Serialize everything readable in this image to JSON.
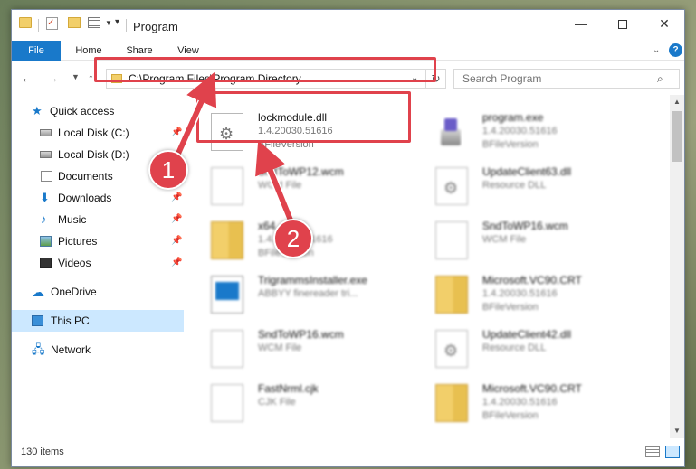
{
  "window": {
    "title": "Program",
    "controls": {
      "minimize": "—",
      "close": "✕"
    }
  },
  "ribbon": {
    "tabs": [
      {
        "label": "File"
      },
      {
        "label": "Home"
      },
      {
        "label": "Share"
      },
      {
        "label": "View"
      }
    ],
    "help": "?"
  },
  "address": {
    "path": "C:\\Program Files\\Program Directory"
  },
  "search": {
    "placeholder": "Search Program"
  },
  "sidebar": {
    "items": [
      {
        "label": "Quick access"
      },
      {
        "label": "Local Disk (C:)"
      },
      {
        "label": "Local Disk (D:)"
      },
      {
        "label": "Documents"
      },
      {
        "label": "Downloads"
      },
      {
        "label": "Music"
      },
      {
        "label": "Pictures"
      },
      {
        "label": "Videos"
      },
      {
        "label": "OneDrive"
      },
      {
        "label": "This PC"
      },
      {
        "label": "Network"
      }
    ]
  },
  "files": [
    {
      "name": "lockmodule.dll",
      "line1": "1.4.20030.51616",
      "line2": "BFileVersion"
    },
    {
      "name": "program.exe",
      "line1": "1.4.20030.51616",
      "line2": "BFileVersion"
    },
    {
      "name": "SndToWP12.wcm",
      "line1": "WCM File",
      "line2": ""
    },
    {
      "name": "UpdateClient63.dll",
      "line1": "Resource DLL",
      "line2": ""
    },
    {
      "name": "x64",
      "line1": "1.4.20030.51616",
      "line2": "BFileVersion"
    },
    {
      "name": "SndToWP16.wcm",
      "line1": "WCM File",
      "line2": ""
    },
    {
      "name": "TrigrammsInstaller.exe",
      "line1": "ABBYY finereader tri...",
      "line2": ""
    },
    {
      "name": "Microsoft.VC90.CRT",
      "line1": "1.4.20030.51616",
      "line2": "BFileVersion"
    },
    {
      "name": "SndToWP16.wcm",
      "line1": "WCM File",
      "line2": ""
    },
    {
      "name": "UpdateClient42.dll",
      "line1": "Resource DLL",
      "line2": ""
    },
    {
      "name": "FastNrml.cjk",
      "line1": "CJK File",
      "line2": ""
    },
    {
      "name": "Microsoft.VC90.CRT",
      "line1": "1.4.20030.51616",
      "line2": "BFileVersion"
    }
  ],
  "status": {
    "item_count": "130 items"
  },
  "callouts": {
    "one": "1",
    "two": "2"
  },
  "colors": {
    "accent": "#1979ca",
    "highlight": "#e0424c",
    "selection": "#cce8ff"
  }
}
